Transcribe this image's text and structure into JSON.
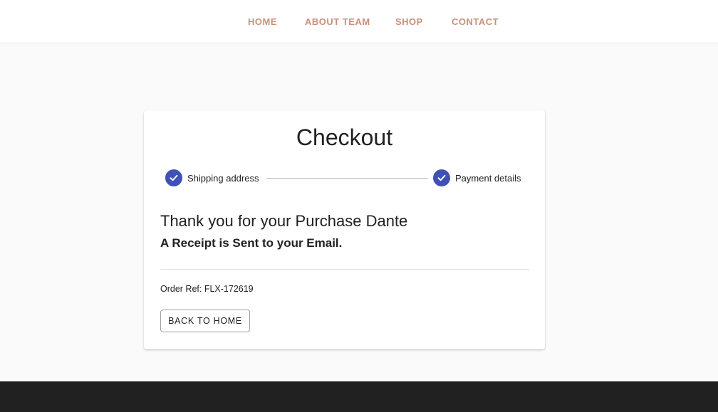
{
  "colors": {
    "nav_text": "#c9907a",
    "step_done": "#3f51b5",
    "footer_bg": "#212121",
    "page_bg": "#fafafa"
  },
  "nav": {
    "items": [
      {
        "label": "HOME"
      },
      {
        "label": "ABOUT TEAM"
      },
      {
        "label": "SHOP"
      },
      {
        "label": "CONTACT"
      }
    ]
  },
  "checkout": {
    "title": "Checkout",
    "steps": [
      {
        "label": "Shipping address",
        "icon": "check-circle-icon",
        "status": "completed"
      },
      {
        "label": "Payment details",
        "icon": "check-circle-icon",
        "status": "completed"
      }
    ],
    "thanks_message": "Thank you for your Purchase Dante",
    "receipt_message": "A Receipt is Sent to your Email.",
    "order_ref": "Order Ref: FLX-172619",
    "back_button_label": "BACK TO HOME"
  }
}
